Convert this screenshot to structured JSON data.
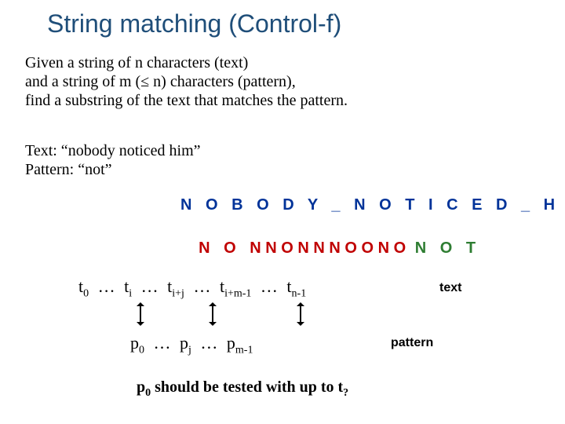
{
  "title": "String matching (Control-f)",
  "desc_l1": "Given a string of n characters (text)",
  "desc_l2": "and a string of m (≤ n) characters (pattern),",
  "desc_l3": "find a substring of the text that matches the pattern.",
  "example_l1": "Text: “nobody noticed him”",
  "example_l2": "Pattern: “not”",
  "text_string": "N O B O D Y _ N O T I C E D _ H I M",
  "overlay_red_left": "N O",
  "overlay_mid": "N N O N N N O O N O",
  "overlay_green": "N O T",
  "t0": "t",
  "ti": "t",
  "tij": "t",
  "tim1": "t",
  "tn1": "t",
  "p0": "p",
  "pj": "p",
  "pm1": "p",
  "idx0": "0",
  "idxi": "i",
  "idxij": "i+j",
  "idxim1": "i+m-1",
  "idxn1": "n-1",
  "idxp0": "0",
  "idxpj": "j",
  "idxpm1": "m-1",
  "ell": "…",
  "label_text": "text",
  "label_pattern": "pattern",
  "conclusion_a": "p",
  "conclusion_b": " should be tested with up to t",
  "conclusion_q": "?"
}
